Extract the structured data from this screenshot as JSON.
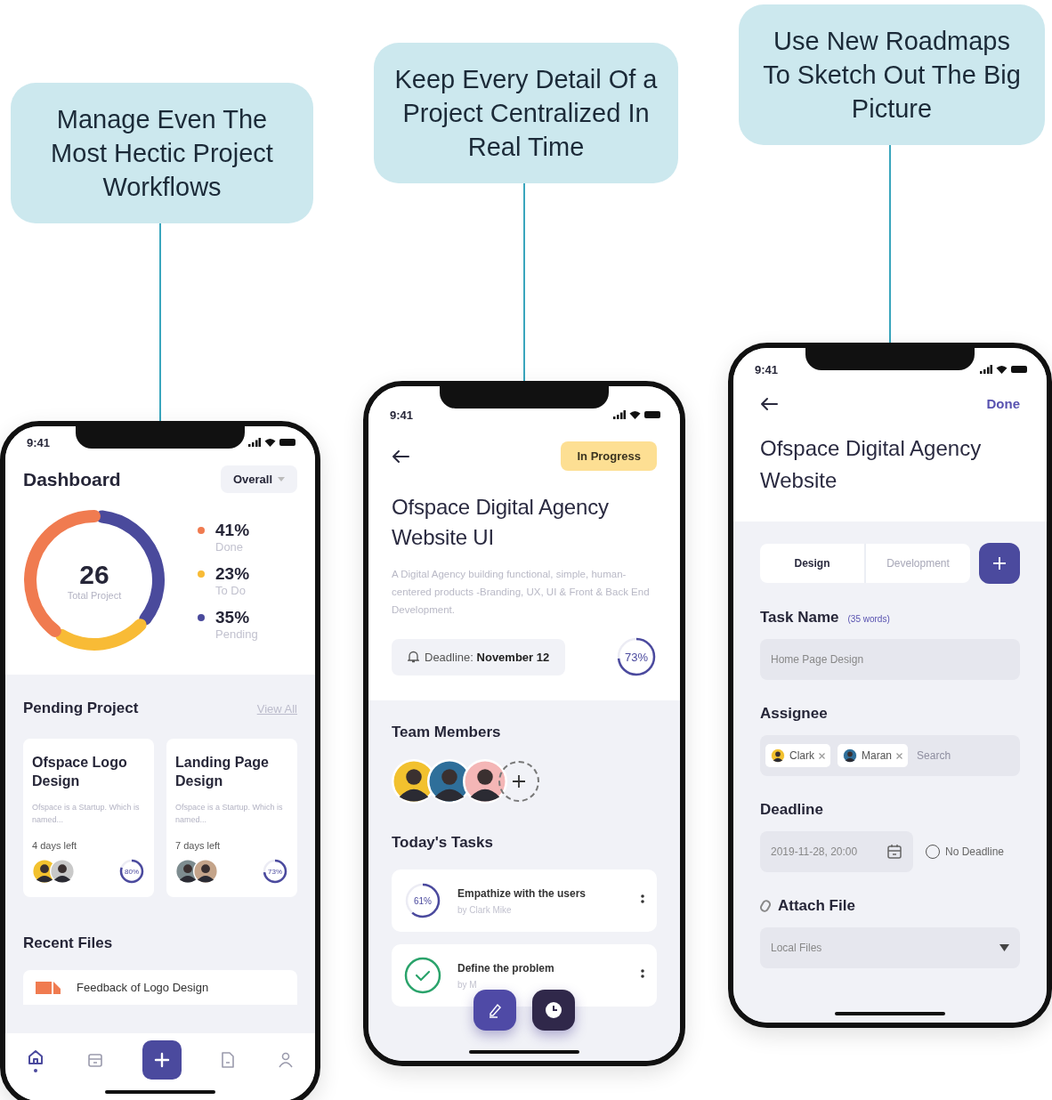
{
  "dashboard": {
    "callout": "Manage Even The Most Hectic Project Workflows",
    "time": "9:41",
    "title": "Dashboard",
    "filter": "Overall",
    "chart_data": {
      "type": "donut",
      "values": [
        41,
        23,
        35
      ],
      "colors": [
        "#f07b50",
        "#f8bb36",
        "#4a4a9c"
      ]
    },
    "total": "26",
    "total_label": "Total Project",
    "legend": [
      {
        "value": "41%",
        "label": "Done",
        "color": "#f07b50"
      },
      {
        "value": "23%",
        "label": "To Do",
        "color": "#f8bb36"
      },
      {
        "value": "35%",
        "label": "Pending",
        "color": "#4a4a9c"
      }
    ],
    "pending_title": "Pending Project",
    "view_all": "View All",
    "projects": [
      {
        "title": "Ofspace Logo Design",
        "description": "Ofspace is a Startup. Which is named...",
        "days_left": "4 days left",
        "progress": "80%",
        "members": [
          {
            "color": "#f2c12e"
          },
          {
            "color": "#c9c9c9"
          }
        ]
      },
      {
        "title": "Landing Page Design",
        "description": "Ofspace is a Startup. Which is named...",
        "days_left": "7 days left",
        "progress": "73%",
        "members": [
          {
            "color": "#7d8c8f"
          },
          {
            "color": "#c4a48a"
          }
        ]
      }
    ],
    "recent_title": "Recent Files",
    "files": [
      {
        "name": "Feedback of Logo Design"
      }
    ],
    "nav": [
      {
        "kind": "home",
        "selected": true
      },
      {
        "kind": "calendar",
        "selected": false
      },
      {
        "kind": "add",
        "selected": false
      },
      {
        "kind": "file",
        "selected": false
      },
      {
        "kind": "profile",
        "selected": false
      }
    ]
  },
  "project": {
    "callout": "Keep Every Detail Of a Project Centralized In Real Time",
    "time": "9:41",
    "status": "In Progress",
    "title": "Ofspace Digital Agency Website UI",
    "description": "A Digital Agency building functional, simple, human-centered products -Branding, UX, UI & Front & Back End Development.",
    "deadline": "Deadline: **November 12**",
    "progress": "73%",
    "team_title": "Team Members",
    "members": [
      {
        "color": "#f2c12e"
      },
      {
        "color": "#2f6f9a"
      },
      {
        "color": "#f4b6b6"
      }
    ],
    "tasks_title": "Today's Tasks",
    "tasks": [
      {
        "kind": "progress",
        "title": "Empathize with the users",
        "by": "by Clark Mike",
        "progress": "61%"
      },
      {
        "kind": "done",
        "title": "Define the problem",
        "by": "by M"
      }
    ]
  },
  "task_form": {
    "callout": "Use New Roadmaps To Sketch Out The Big Picture",
    "time": "9:41",
    "done": "Done",
    "title": "Ofspace Digital Agency Website",
    "tabs": [
      {
        "label": "Design",
        "selected": true
      },
      {
        "label": "Development",
        "selected": false
      }
    ],
    "task_name_label": "Task Name",
    "word_count": "(35 words)",
    "task_name": "Home Page Design",
    "assignee_label": "Assignee",
    "assignees": [
      {
        "name": "Clark",
        "color": "#f2c12e"
      },
      {
        "name": "Maran",
        "color": "#2f6f9a"
      }
    ],
    "assignee_placeholder": "Search",
    "deadline_label": "Deadline",
    "deadline": "2019-11-28, 20:00",
    "no_deadline": {
      "label": "No Deadline",
      "checked": false
    },
    "attach_label": "Attach File",
    "attach_source": "Local Files"
  }
}
